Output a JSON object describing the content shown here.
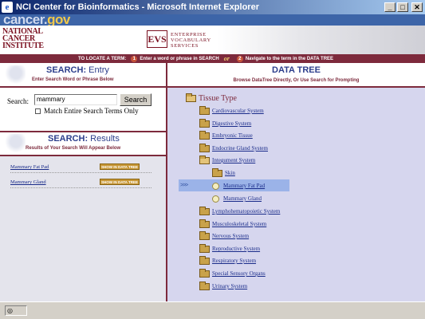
{
  "window": {
    "title": "NCI Center for Bioinformatics - Microsoft Internet Explorer",
    "min": "_",
    "max": "□",
    "close": "✕"
  },
  "header": {
    "cancergov_logo_main": "cancer.",
    "cancergov_logo_suffix": "gov",
    "nci_lines": [
      "NATIONAL",
      "CANCER",
      "INSTITUTE"
    ],
    "evs_mark": "EVS",
    "evs_lines": [
      "ENTERPRISE",
      "VOCABULARY",
      "SERVICES"
    ]
  },
  "instructions": {
    "lead": "TO LOCATE A TERM:",
    "step1_num": "1",
    "step1": "Enter a word or phrase in SEARCH",
    "or": "or",
    "step2_num": "2",
    "step2": "Navigate to the term in the DATA TREE"
  },
  "search_entry": {
    "title_bold": "SEARCH:",
    "title_light": " Entry",
    "subtitle": "Enter Search Word or Phrase Below",
    "label": "Search:",
    "value": "mammary",
    "button": "Search",
    "checkbox_label": "Match Entire Search Terms Only",
    "checkbox_checked": false
  },
  "search_results": {
    "title_bold": "SEARCH:",
    "title_light": " Results",
    "subtitle": "Results of Your Search Will Appear Below",
    "show_label": "SHOW IN DATA TREE",
    "items": [
      {
        "label": "Mammary Fat Pad"
      },
      {
        "label": "Mammary Gland"
      }
    ]
  },
  "data_tree": {
    "title": "DATA TREE",
    "subtitle": "Browse DataTree Directly, Or Use Search for Prompting",
    "root": "Tissue Type",
    "selected_marker": ">>>",
    "nodes": [
      {
        "label": "Cardiovascular System"
      },
      {
        "label": "Digestive System"
      },
      {
        "label": "Embryonic Tissue"
      },
      {
        "label": "Endocrine Gland System"
      },
      {
        "label": "Integument System"
      },
      {
        "label": "Skin"
      },
      {
        "label": "Mammary Fat Pad"
      },
      {
        "label": "Mammary Gland"
      },
      {
        "label": "Lymphohematopoietic System"
      },
      {
        "label": "Musculoskeletal System"
      },
      {
        "label": "Nervous System"
      },
      {
        "label": "Reproductive System"
      },
      {
        "label": "Respiratory System"
      },
      {
        "label": "Special Sensory Organs"
      },
      {
        "label": "Urinary System"
      }
    ]
  },
  "status": {
    "icon_text": "◎"
  },
  "colors": {
    "maroon": "#7d2a3c",
    "navy": "#2c3e8c",
    "tree_bg": "#d6d6ee",
    "highlight": "#9bb3e8"
  }
}
